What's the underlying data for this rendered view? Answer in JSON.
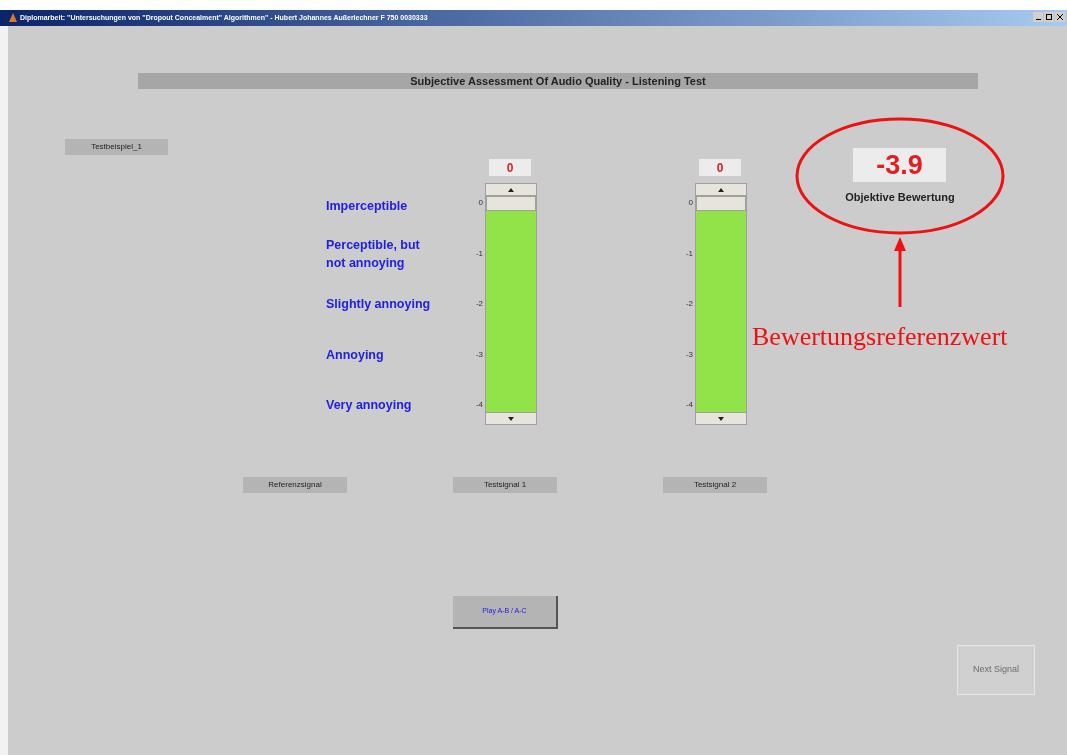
{
  "window": {
    "title": "Diplomarbeit: \"Untersuchungen von \"Dropout Concealment\" Algorithmen\" - Hubert Johannes Außerlechner F 750 0030333"
  },
  "header": "Subjective Assessment Of Audio Quality - Listening Test",
  "example_label": "Testbeispiel_1",
  "scale_labels": [
    "Imperceptible",
    "Perceptible, but not annoying",
    "Slightly annoying",
    "Annoying",
    "Very annoying"
  ],
  "sliders": [
    {
      "value": "0",
      "level": 1,
      "ticks": [
        "0",
        "-1",
        "-2",
        "-3",
        "-4"
      ]
    },
    {
      "value": "0",
      "level": 1,
      "ticks": [
        "0",
        "-1",
        "-2",
        "-3",
        "-4"
      ]
    }
  ],
  "objective": {
    "value": "-3.9",
    "label": "Objektive Bewertung"
  },
  "signal_buttons": [
    "Referenzsignal",
    "Testsignal 1",
    "Testsignal 2"
  ],
  "play_button": "Play A-B / A-C",
  "next_button": {
    "label": "Next Signal",
    "disabled": true
  },
  "annotation": {
    "text": "Bewertungsreferenzwert"
  }
}
